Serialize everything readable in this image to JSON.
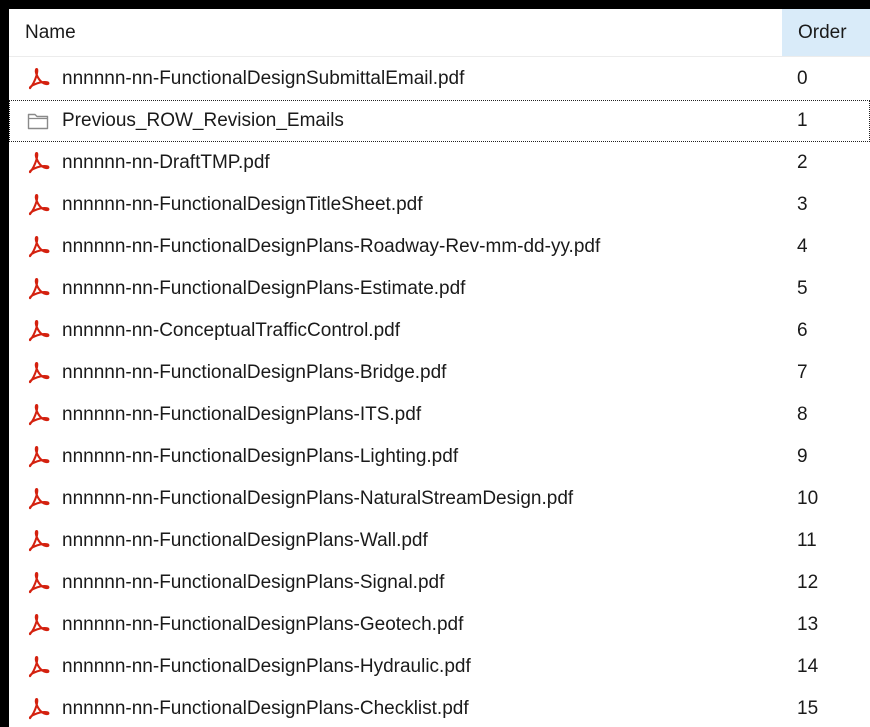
{
  "header": {
    "name_label": "Name",
    "order_label": "Order"
  },
  "colors": {
    "pdf_icon": "#d4210f",
    "folder_icon": "#8a8a8a",
    "sorted_column_bg": "#d9ebf9"
  },
  "files": [
    {
      "name": "nnnnnn-nn-FunctionalDesignSubmittalEmail.pdf",
      "order": "0",
      "icon": "pdf-icon"
    },
    {
      "name": "Previous_ROW_Revision_Emails",
      "order": "1",
      "icon": "folder-icon"
    },
    {
      "name": "nnnnnn-nn-DraftTMP.pdf",
      "order": "2",
      "icon": "pdf-icon"
    },
    {
      "name": "nnnnnn-nn-FunctionalDesignTitleSheet.pdf",
      "order": "3",
      "icon": "pdf-icon"
    },
    {
      "name": "nnnnnn-nn-FunctionalDesignPlans-Roadway-Rev-mm-dd-yy.pdf",
      "order": "4",
      "icon": "pdf-icon"
    },
    {
      "name": "nnnnnn-nn-FunctionalDesignPlans-Estimate.pdf",
      "order": "5",
      "icon": "pdf-icon"
    },
    {
      "name": "nnnnnn-nn-ConceptualTrafficControl.pdf",
      "order": "6",
      "icon": "pdf-icon"
    },
    {
      "name": "nnnnnn-nn-FunctionalDesignPlans-Bridge.pdf",
      "order": "7",
      "icon": "pdf-icon"
    },
    {
      "name": "nnnnnn-nn-FunctionalDesignPlans-ITS.pdf",
      "order": "8",
      "icon": "pdf-icon"
    },
    {
      "name": "nnnnnn-nn-FunctionalDesignPlans-Lighting.pdf",
      "order": "9",
      "icon": "pdf-icon"
    },
    {
      "name": "nnnnnn-nn-FunctionalDesignPlans-NaturalStreamDesign.pdf",
      "order": "10",
      "icon": "pdf-icon"
    },
    {
      "name": "nnnnnn-nn-FunctionalDesignPlans-Wall.pdf",
      "order": "11",
      "icon": "pdf-icon"
    },
    {
      "name": "nnnnnn-nn-FunctionalDesignPlans-Signal.pdf",
      "order": "12",
      "icon": "pdf-icon"
    },
    {
      "name": "nnnnnn-nn-FunctionalDesignPlans-Geotech.pdf",
      "order": "13",
      "icon": "pdf-icon"
    },
    {
      "name": "nnnnnn-nn-FunctionalDesignPlans-Hydraulic.pdf",
      "order": "14",
      "icon": "pdf-icon"
    },
    {
      "name": "nnnnnn-nn-FunctionalDesignPlans-Checklist.pdf",
      "order": "15",
      "icon": "pdf-icon"
    }
  ]
}
